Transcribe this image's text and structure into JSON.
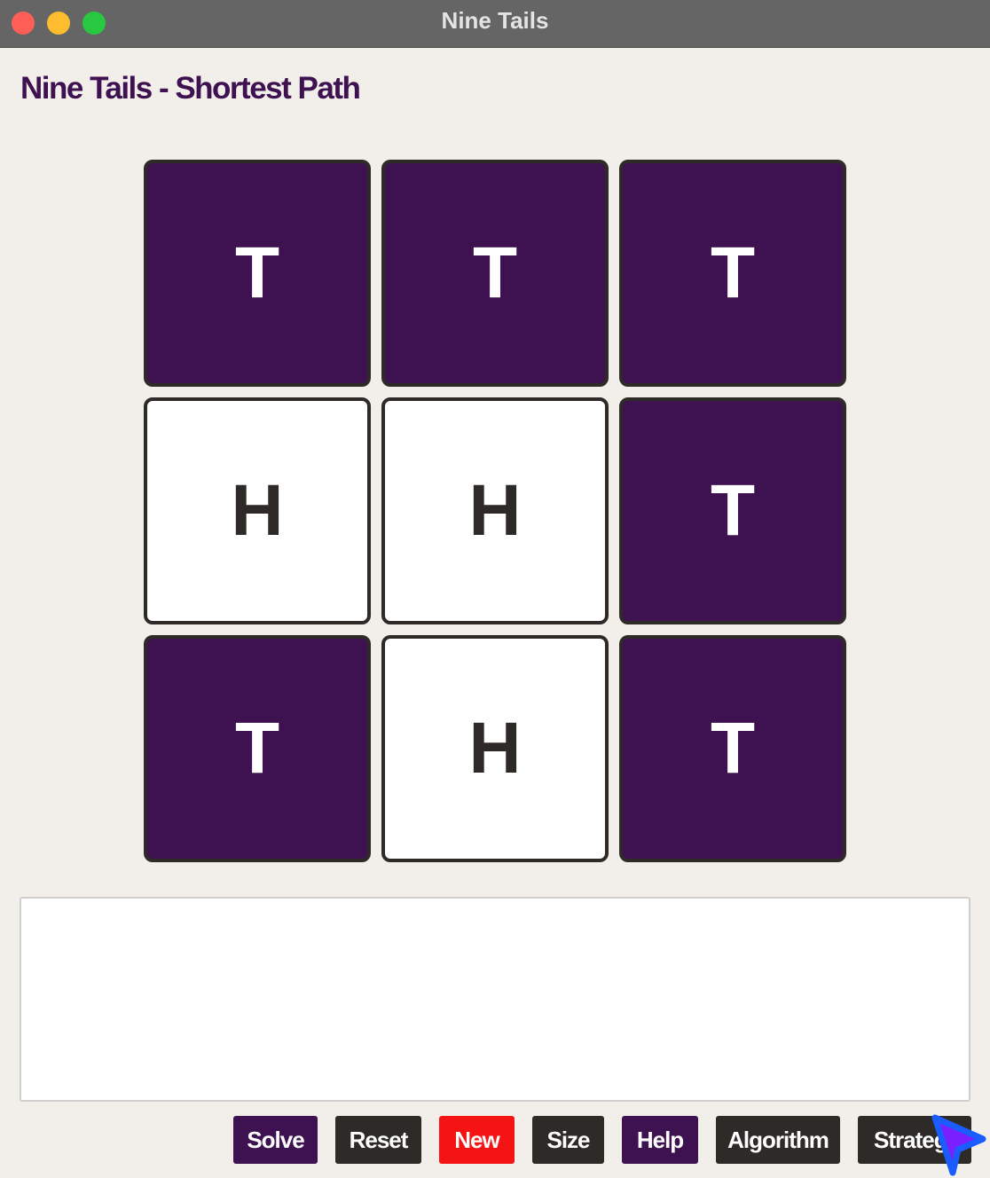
{
  "window": {
    "title": "Nine Tails"
  },
  "page": {
    "title": "Nine Tails - Shortest Path"
  },
  "grid": {
    "cells": [
      {
        "label": "T",
        "state": "tail"
      },
      {
        "label": "T",
        "state": "tail"
      },
      {
        "label": "T",
        "state": "tail"
      },
      {
        "label": "H",
        "state": "head"
      },
      {
        "label": "H",
        "state": "head"
      },
      {
        "label": "T",
        "state": "tail"
      },
      {
        "label": "T",
        "state": "tail"
      },
      {
        "label": "H",
        "state": "head"
      },
      {
        "label": "T",
        "state": "tail"
      }
    ]
  },
  "output": {
    "text": ""
  },
  "toolbar": {
    "solve_label": "Solve",
    "reset_label": "Reset",
    "new_label": "New",
    "size_label": "Size",
    "help_label": "Help",
    "algorithm_label": "Algorithm",
    "strategy_label": "Strategy"
  },
  "colors": {
    "tail_bg": "#3e1150",
    "head_bg": "#ffffff",
    "primary_button": "#3e1150",
    "secondary_button": "#2e2a28",
    "danger_button": "#f41413",
    "title_text": "#3e1150",
    "cursor": "#1a5cff"
  },
  "icons": {
    "cursor": "pointer-arrow-icon"
  }
}
